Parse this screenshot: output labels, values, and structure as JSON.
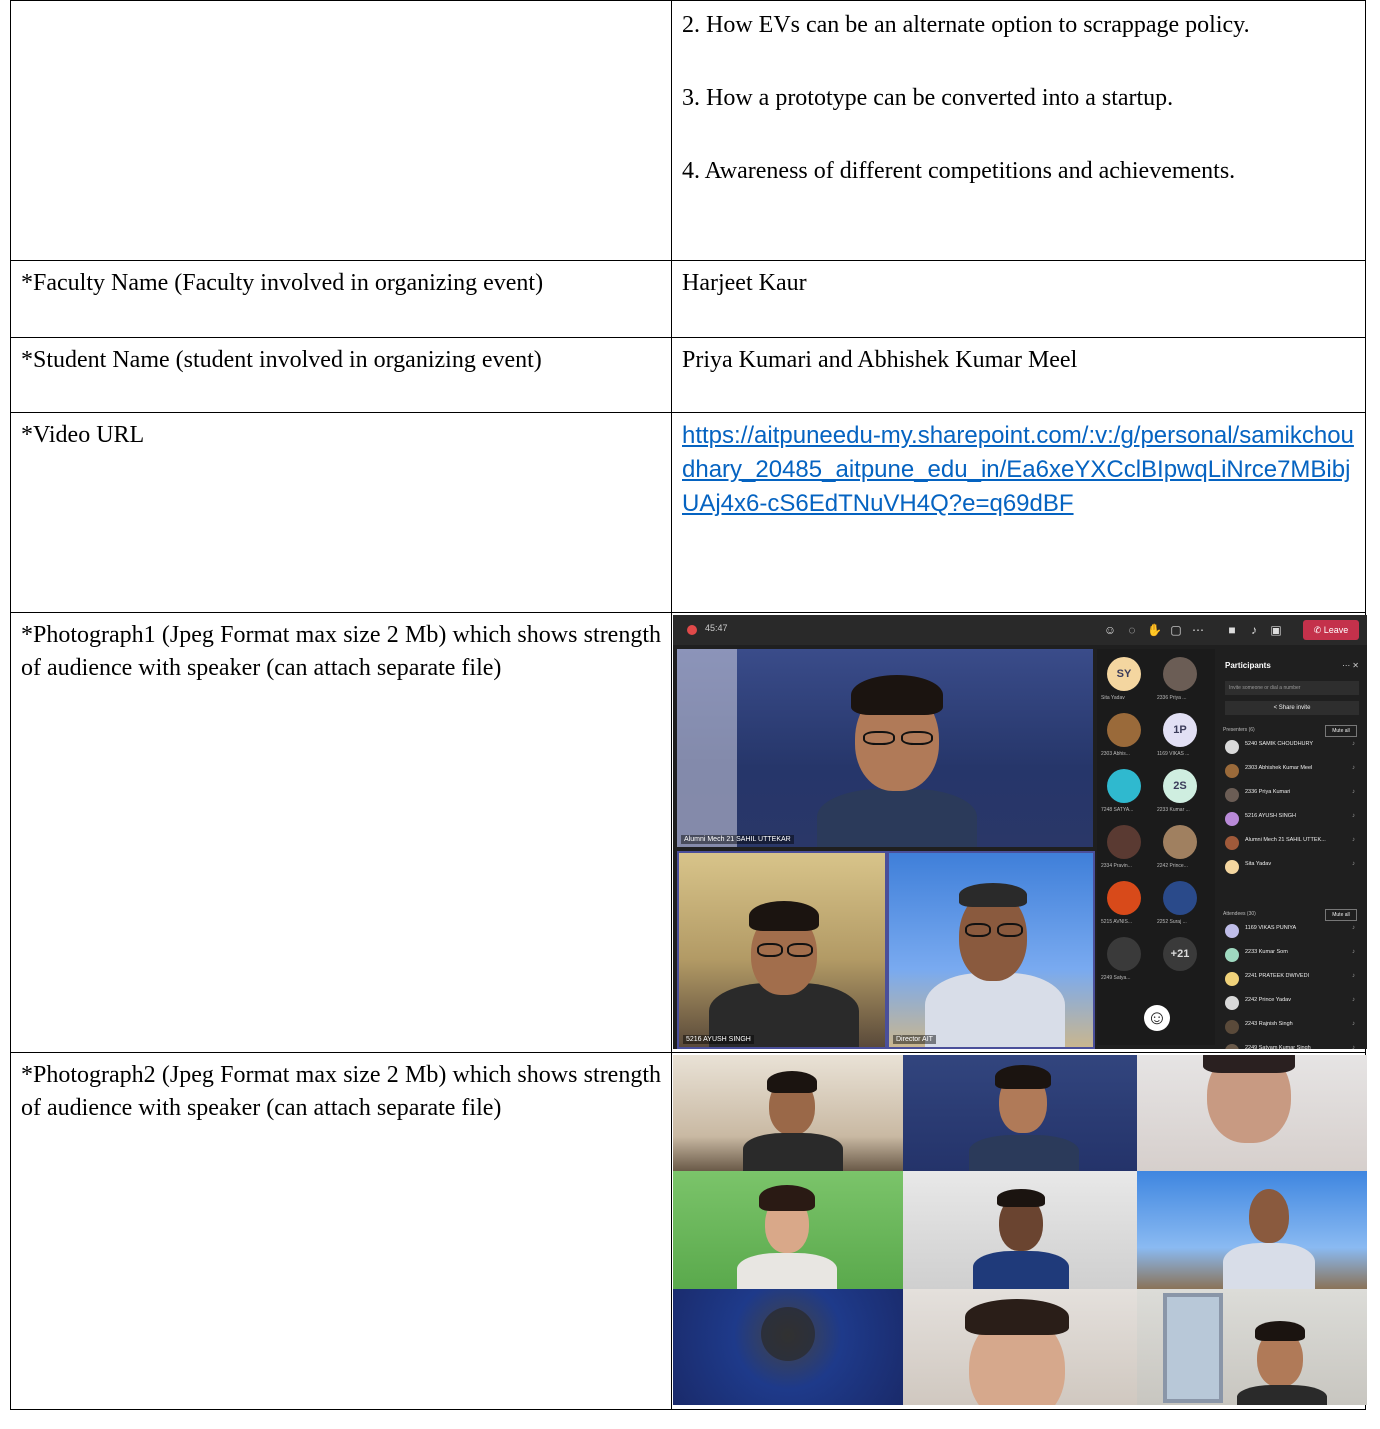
{
  "points": [
    "2. How EVs can be an alternate option to scrappage policy.",
    "3. How a prototype can be converted into a startup.",
    "4. Awareness of different competitions and achievements."
  ],
  "rows": {
    "faculty_label": "*Faculty Name (Faculty involved in organizing event)",
    "faculty_value": "Harjeet Kaur",
    "student_label": "*Student Name (student involved in organizing event)",
    "student_value": "Priya Kumari and Abhishek Kumar Meel",
    "video_label": "*Video URL",
    "video_url": "https://aitpuneedu-my.sharepoint.com/:v:/g/personal/samikchoudhary_20485_aitpune_edu_in/Ea6xeYXCclBIpwqLiNrce7MBibjUAj4x6-cS6EdTNuVH4Q?e=q69dBF",
    "photo1_label": "*Photograph1 (Jpeg Format max size 2 Mb) which shows strength of audience with speaker (can attach separate file)",
    "photo2_label": "*Photograph2 (Jpeg Format max size 2 Mb) which shows strength of audience with speaker (can attach separate file)"
  },
  "meeting": {
    "timer": "45:47",
    "leave_label": "Leave",
    "main_speaker": "Alumni Mech 21 SAHIL UTTEKAR",
    "tile2_name": "5216 AYUSH SINGH",
    "tile3_name": "Director AIT",
    "grid": [
      {
        "name": "Sita Yadav",
        "initials": "SY",
        "color": "#f4d6a0"
      },
      {
        "name": "2336 Priya ...",
        "initials": "",
        "color": "#6b5d55"
      },
      {
        "name": "2303 Abhis...",
        "initials": "",
        "color": "#9a6a3a"
      },
      {
        "name": "1169 VIKAS ...",
        "initials": "1P",
        "color": "#e2e0f4"
      },
      {
        "name": "7248 SATYA...",
        "initials": "",
        "color": "#2fb9cf"
      },
      {
        "name": "2233 Kumar ...",
        "initials": "2S",
        "color": "#cfeee0"
      },
      {
        "name": "2334 Pravin...",
        "initials": "",
        "color": "#5a3a32"
      },
      {
        "name": "2242 Prince...",
        "initials": "",
        "color": "#a08060"
      },
      {
        "name": "5215 AVNIS...",
        "initials": "",
        "color": "#d84a1a"
      },
      {
        "name": "2252 Suraj ...",
        "initials": "",
        "color": "#2a4a8a"
      },
      {
        "name": "2249 Satya...",
        "initials": "",
        "color": "#3a3a3a"
      },
      {
        "name": "",
        "initials": "+21",
        "color": "#3a3a3a"
      }
    ],
    "panel": {
      "title": "Participants",
      "invite_placeholder": "Invite someone or dial a number",
      "share_invite": "Share invite",
      "presenters_label": "Presenters (6)",
      "attendees_label": "Attendees (30)",
      "mute_all": "Mute all",
      "presenters": [
        {
          "name": "5240 SAMIK CHOUDHURY",
          "color": "#d9d9d9"
        },
        {
          "name": "2303 Abhishek Kumar Meel",
          "color": "#9a6a3a"
        },
        {
          "name": "2336 Priya Kumari",
          "color": "#6b5d55"
        },
        {
          "name": "5216 AYUSH SINGH",
          "color": "#b98ad8"
        },
        {
          "name": "Alumni Mech 21 SAHIL UTTEK...",
          "color": "#a05a3a"
        },
        {
          "name": "Sita Yadav",
          "color": "#f4d6a0"
        }
      ],
      "attendees": [
        {
          "name": "1169 VIKAS PUNIYA",
          "color": "#bfbde8"
        },
        {
          "name": "2233 Kumar Som",
          "color": "#9fd9c0"
        },
        {
          "name": "2241 PRATEEK DWIVEDI",
          "color": "#f0d27a"
        },
        {
          "name": "2242 Prince Yadav",
          "color": "#d8d8d8"
        },
        {
          "name": "2243 Rajnish Singh",
          "color": "#5a4a3a"
        },
        {
          "name": "2249 Satyam Kumar Singh",
          "color": "#6a5a4a"
        }
      ]
    }
  }
}
